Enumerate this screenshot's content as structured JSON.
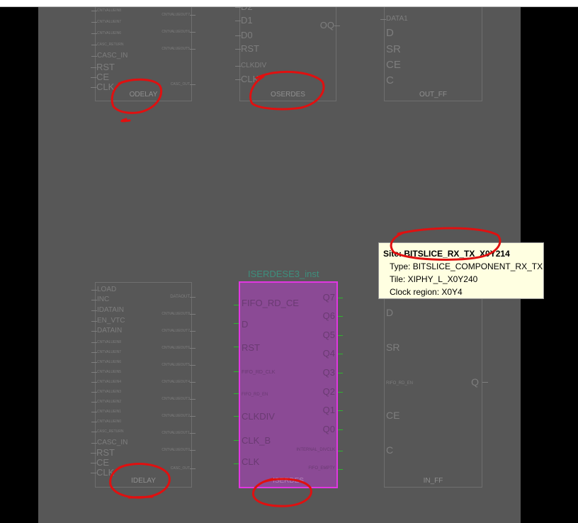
{
  "annotation_color": "#e01010",
  "selection_color": "#e236e2",
  "cells": {
    "odelay_top": {
      "name": "ODELAY",
      "inputs": [
        "CNTVALUEIN8",
        "CNTVALUEIN7",
        "CNTVALUEIN6",
        "CASC_RETURN",
        "CASC_IN",
        "RST",
        "CE",
        "CLK"
      ],
      "outputs": [
        "CNTVALUEOUT7",
        "CNTVALUEOUT6",
        "CNTVALUEOUT5",
        "CASC_OUT"
      ]
    },
    "oserdes": {
      "name": "OSERDES",
      "inputs": [
        "D2",
        "D1",
        "D0",
        "RST",
        "CLKDIV",
        "CLK"
      ],
      "outputs": [
        "OQ"
      ]
    },
    "out_ff": {
      "name": "OUT_FF",
      "inputs": [
        "DATA1",
        "D",
        "SR",
        "CE",
        "C"
      ]
    },
    "idelay": {
      "name": "IDELAY",
      "inputs": [
        "LOAD",
        "INC",
        "IDATAIN",
        "EN_VTC",
        "DATAIN",
        "CNTVALUEIN8",
        "CNTVALUEIN7",
        "CNTVALUEIN6",
        "CNTVALUEIN5",
        "CNTVALUEIN4",
        "CNTVALUEIN3",
        "CNTVALUEIN2",
        "CNTVALUEIN1",
        "CNTVALUEIN0",
        "CASC_RETURN",
        "CASC_IN",
        "RST",
        "CE",
        "CLK"
      ],
      "outputs": [
        "DATAOUT",
        "CNTVALUEOUT8",
        "CNTVALUEOUT7",
        "CNTVALUEOUT6",
        "CNTVALUEOUT5",
        "CNTVALUEOUT4",
        "CNTVALUEOUT3",
        "CNTVALUEOUT2",
        "CNTVALUEOUT1",
        "CNTVALUEOUT0",
        "CASC_OUT"
      ]
    },
    "iserdes": {
      "name": "ISERDES",
      "instance": "ISERDESE3_inst",
      "inputs": [
        "FIFO_RD_CE",
        "D",
        "RST",
        "FIFO_RD_CLK",
        "FIFO_RD_EN",
        "CLKDIV",
        "CLK_B",
        "CLK"
      ],
      "outputs": [
        "Q7",
        "Q6",
        "Q5",
        "Q4",
        "Q3",
        "Q2",
        "Q1",
        "Q0",
        "INTERNAL_DIVCLK",
        "FIFO_EMPTY"
      ]
    },
    "in_ff": {
      "name": "IN_FF",
      "inputs": [
        "D",
        "SR",
        "RIFO_RD_EN",
        "CE",
        "C"
      ],
      "outputs": [
        "Q"
      ]
    }
  },
  "tooltip": {
    "site_label": "Site:",
    "site": "BITSLICE_RX_TX_X0Y214",
    "type_label": "Type:",
    "type": "BITSLICE_COMPONENT_RX_TX",
    "tile_label": "Tile:",
    "tile": "XIPHY_L_X0Y240",
    "clock_label": "Clock region:",
    "clock": "X0Y4"
  }
}
